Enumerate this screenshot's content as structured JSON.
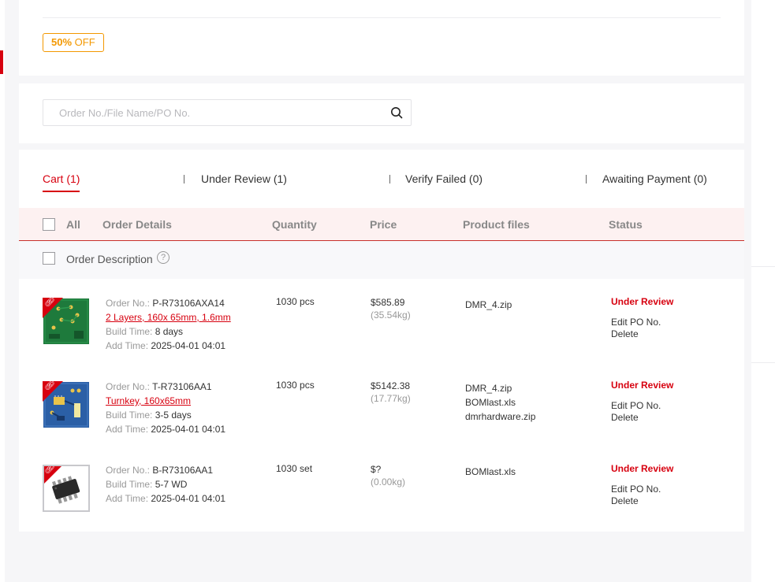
{
  "promo": {
    "discount_strong": "50%",
    "discount_rest": " OFF"
  },
  "search": {
    "placeholder": "Order No./File Name/PO No."
  },
  "tabs": [
    {
      "label": "Cart (1)"
    },
    {
      "label": "Under Review (1)"
    },
    {
      "label": "Verify Failed (0)"
    },
    {
      "label": "Awaiting Payment (0)"
    }
  ],
  "table_head": {
    "all": "All",
    "details": "Order Details",
    "quantity": "Quantity",
    "price": "Price",
    "files": "Product files",
    "status": "Status"
  },
  "order_description": {
    "label": "Order Description",
    "help": "?"
  },
  "labels": {
    "order_no": "Order No.: ",
    "build_time": "Build Time: ",
    "add_time": "Add Time: "
  },
  "orders": [
    {
      "order_no": "P-R73106AXA14",
      "spec": "2 Layers, 160x 65mm, 1.6mm",
      "build_time": "8 days",
      "add_time": "2025-04-01 04:01",
      "quantity": "1030 pcs",
      "price": "$585.89",
      "weight": "(35.54kg)",
      "files": [
        "DMR_4.zip"
      ],
      "status": "Under Review",
      "action_edit": "Edit PO No.",
      "action_delete": "Delete"
    },
    {
      "order_no": "T-R73106AA1",
      "spec": "Turnkey, 160x65mm",
      "build_time": "3-5 days",
      "add_time": "2025-04-01 04:01",
      "quantity": "1030 pcs",
      "price": "$5142.38",
      "weight": "(17.77kg)",
      "files": [
        "DMR_4.zip",
        "BOMlast.xls",
        "dmrhardware.zip"
      ],
      "status": "Under Review",
      "action_edit": "Edit PO No.",
      "action_delete": "Delete"
    },
    {
      "order_no": "B-R73106AA1",
      "build_time": "5-7 WD",
      "add_time": "2025-04-01 04:01",
      "quantity": "1030 set",
      "price": "$?",
      "weight": "(0.00kg)",
      "files": [
        "BOMlast.xls"
      ],
      "status": "Under Review",
      "action_edit": "Edit PO No.",
      "action_delete": "Delete"
    }
  ],
  "icons": {
    "search": "search-icon",
    "link": "link-icon",
    "help": "help-icon"
  },
  "colors": {
    "accent": "#d7000f",
    "promo": "#f39800",
    "pcb_green": "#1e7a3c",
    "pcba_blue": "#2b5fa6"
  }
}
